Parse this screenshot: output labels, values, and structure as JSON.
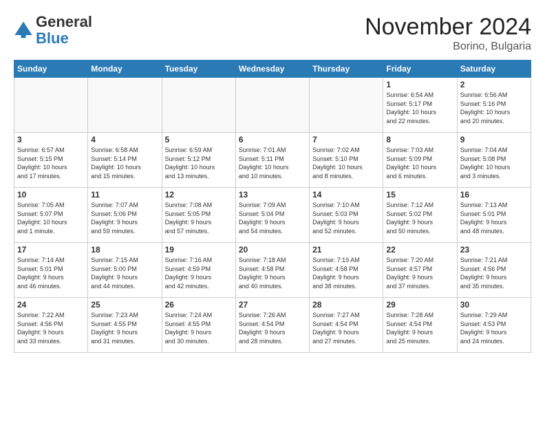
{
  "logo": {
    "general": "General",
    "blue": "Blue"
  },
  "title": "November 2024",
  "location": "Borino, Bulgaria",
  "days_of_week": [
    "Sunday",
    "Monday",
    "Tuesday",
    "Wednesday",
    "Thursday",
    "Friday",
    "Saturday"
  ],
  "weeks": [
    [
      {
        "day": "",
        "info": ""
      },
      {
        "day": "",
        "info": ""
      },
      {
        "day": "",
        "info": ""
      },
      {
        "day": "",
        "info": ""
      },
      {
        "day": "",
        "info": ""
      },
      {
        "day": "1",
        "info": "Sunrise: 6:54 AM\nSunset: 5:17 PM\nDaylight: 10 hours\nand 22 minutes."
      },
      {
        "day": "2",
        "info": "Sunrise: 6:56 AM\nSunset: 5:16 PM\nDaylight: 10 hours\nand 20 minutes."
      }
    ],
    [
      {
        "day": "3",
        "info": "Sunrise: 6:57 AM\nSunset: 5:15 PM\nDaylight: 10 hours\nand 17 minutes."
      },
      {
        "day": "4",
        "info": "Sunrise: 6:58 AM\nSunset: 5:14 PM\nDaylight: 10 hours\nand 15 minutes."
      },
      {
        "day": "5",
        "info": "Sunrise: 6:59 AM\nSunset: 5:12 PM\nDaylight: 10 hours\nand 13 minutes."
      },
      {
        "day": "6",
        "info": "Sunrise: 7:01 AM\nSunset: 5:11 PM\nDaylight: 10 hours\nand 10 minutes."
      },
      {
        "day": "7",
        "info": "Sunrise: 7:02 AM\nSunset: 5:10 PM\nDaylight: 10 hours\nand 8 minutes."
      },
      {
        "day": "8",
        "info": "Sunrise: 7:03 AM\nSunset: 5:09 PM\nDaylight: 10 hours\nand 6 minutes."
      },
      {
        "day": "9",
        "info": "Sunrise: 7:04 AM\nSunset: 5:08 PM\nDaylight: 10 hours\nand 3 minutes."
      }
    ],
    [
      {
        "day": "10",
        "info": "Sunrise: 7:05 AM\nSunset: 5:07 PM\nDaylight: 10 hours\nand 1 minute."
      },
      {
        "day": "11",
        "info": "Sunrise: 7:07 AM\nSunset: 5:06 PM\nDaylight: 9 hours\nand 59 minutes."
      },
      {
        "day": "12",
        "info": "Sunrise: 7:08 AM\nSunset: 5:05 PM\nDaylight: 9 hours\nand 57 minutes."
      },
      {
        "day": "13",
        "info": "Sunrise: 7:09 AM\nSunset: 5:04 PM\nDaylight: 9 hours\nand 54 minutes."
      },
      {
        "day": "14",
        "info": "Sunrise: 7:10 AM\nSunset: 5:03 PM\nDaylight: 9 hours\nand 52 minutes."
      },
      {
        "day": "15",
        "info": "Sunrise: 7:12 AM\nSunset: 5:02 PM\nDaylight: 9 hours\nand 50 minutes."
      },
      {
        "day": "16",
        "info": "Sunrise: 7:13 AM\nSunset: 5:01 PM\nDaylight: 9 hours\nand 48 minutes."
      }
    ],
    [
      {
        "day": "17",
        "info": "Sunrise: 7:14 AM\nSunset: 5:01 PM\nDaylight: 9 hours\nand 46 minutes."
      },
      {
        "day": "18",
        "info": "Sunrise: 7:15 AM\nSunset: 5:00 PM\nDaylight: 9 hours\nand 44 minutes."
      },
      {
        "day": "19",
        "info": "Sunrise: 7:16 AM\nSunset: 4:59 PM\nDaylight: 9 hours\nand 42 minutes."
      },
      {
        "day": "20",
        "info": "Sunrise: 7:18 AM\nSunset: 4:58 PM\nDaylight: 9 hours\nand 40 minutes."
      },
      {
        "day": "21",
        "info": "Sunrise: 7:19 AM\nSunset: 4:58 PM\nDaylight: 9 hours\nand 38 minutes."
      },
      {
        "day": "22",
        "info": "Sunrise: 7:20 AM\nSunset: 4:57 PM\nDaylight: 9 hours\nand 37 minutes."
      },
      {
        "day": "23",
        "info": "Sunrise: 7:21 AM\nSunset: 4:56 PM\nDaylight: 9 hours\nand 35 minutes."
      }
    ],
    [
      {
        "day": "24",
        "info": "Sunrise: 7:22 AM\nSunset: 4:56 PM\nDaylight: 9 hours\nand 33 minutes."
      },
      {
        "day": "25",
        "info": "Sunrise: 7:23 AM\nSunset: 4:55 PM\nDaylight: 9 hours\nand 31 minutes."
      },
      {
        "day": "26",
        "info": "Sunrise: 7:24 AM\nSunset: 4:55 PM\nDaylight: 9 hours\nand 30 minutes."
      },
      {
        "day": "27",
        "info": "Sunrise: 7:26 AM\nSunset: 4:54 PM\nDaylight: 9 hours\nand 28 minutes."
      },
      {
        "day": "28",
        "info": "Sunrise: 7:27 AM\nSunset: 4:54 PM\nDaylight: 9 hours\nand 27 minutes."
      },
      {
        "day": "29",
        "info": "Sunrise: 7:28 AM\nSunset: 4:54 PM\nDaylight: 9 hours\nand 25 minutes."
      },
      {
        "day": "30",
        "info": "Sunrise: 7:29 AM\nSunset: 4:53 PM\nDaylight: 9 hours\nand 24 minutes."
      }
    ]
  ]
}
